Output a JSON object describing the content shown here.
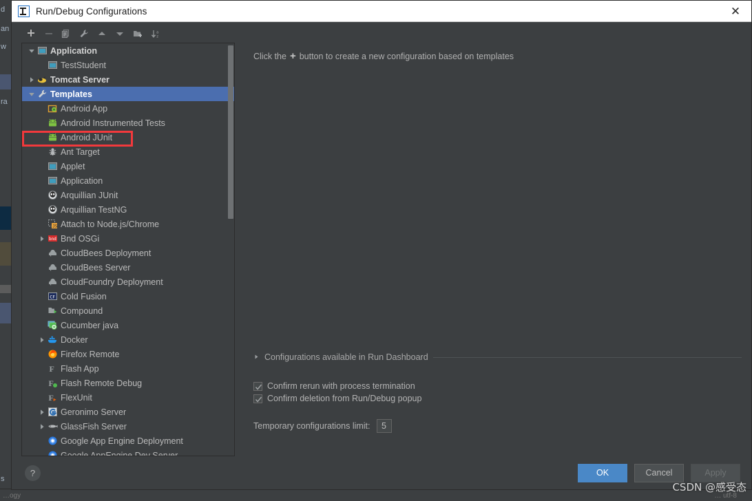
{
  "window": {
    "title": "Run/Debug Configurations",
    "logo_icon": "intellij-idea-logo-icon",
    "close_icon": "close-icon"
  },
  "toolbar": {
    "buttons": [
      {
        "name": "add-configuration-button",
        "icon": "plus-icon",
        "label": "+"
      },
      {
        "name": "remove-configuration-button",
        "icon": "minus-icon",
        "label": "−"
      },
      {
        "name": "copy-configuration-button",
        "icon": "copy-icon",
        "label": "Copy"
      },
      {
        "name": "edit-defaults-button",
        "icon": "wrench-icon",
        "label": "Edit defaults"
      },
      {
        "name": "move-up-button",
        "icon": "arrow-up-icon",
        "label": "Move Up"
      },
      {
        "name": "move-down-button",
        "icon": "arrow-down-icon",
        "label": "Move Down"
      },
      {
        "name": "new-folder-button",
        "icon": "folder-add-icon",
        "label": "New Folder"
      },
      {
        "name": "sort-configurations-button",
        "icon": "sort-alpha-icon",
        "label": "Sort Configurations"
      }
    ]
  },
  "tree": {
    "items": [
      {
        "label": "Application",
        "icon": "application-icon",
        "indent": 0,
        "twisty": "down",
        "bold": true,
        "selected": false
      },
      {
        "label": "TestStudent",
        "icon": "application-icon",
        "indent": 1,
        "twisty": "none",
        "bold": false,
        "selected": false
      },
      {
        "label": "Tomcat Server",
        "icon": "tomcat-icon",
        "indent": 0,
        "twisty": "right",
        "bold": true,
        "selected": false
      },
      {
        "label": "Templates",
        "icon": "wrench-icon",
        "indent": 0,
        "twisty": "down",
        "bold": true,
        "selected": true
      },
      {
        "label": "Android App",
        "icon": "android-app-icon",
        "indent": 1,
        "twisty": "none",
        "bold": false,
        "selected": false
      },
      {
        "label": "Android Instrumented Tests",
        "icon": "android-icon",
        "indent": 1,
        "twisty": "none",
        "bold": false,
        "selected": false
      },
      {
        "label": "Android JUnit",
        "icon": "android-icon",
        "indent": 1,
        "twisty": "none",
        "bold": false,
        "selected": false
      },
      {
        "label": "Ant Target",
        "icon": "ant-icon",
        "indent": 1,
        "twisty": "none",
        "bold": false,
        "selected": false
      },
      {
        "label": "Applet",
        "icon": "applet-icon",
        "indent": 1,
        "twisty": "none",
        "bold": false,
        "selected": false
      },
      {
        "label": "Application",
        "icon": "application-icon",
        "indent": 1,
        "twisty": "none",
        "bold": false,
        "selected": false
      },
      {
        "label": "Arquillian JUnit",
        "icon": "arquillian-icon",
        "indent": 1,
        "twisty": "none",
        "bold": false,
        "selected": false
      },
      {
        "label": "Arquillian TestNG",
        "icon": "arquillian-icon",
        "indent": 1,
        "twisty": "none",
        "bold": false,
        "selected": false
      },
      {
        "label": "Attach to Node.js/Chrome",
        "icon": "nodejs-attach-icon",
        "indent": 1,
        "twisty": "none",
        "bold": false,
        "selected": false
      },
      {
        "label": "Bnd OSGi",
        "icon": "bnd-osgi-icon",
        "indent": 1,
        "twisty": "right",
        "bold": false,
        "selected": false
      },
      {
        "label": "CloudBees Deployment",
        "icon": "cloudbees-icon",
        "indent": 1,
        "twisty": "none",
        "bold": false,
        "selected": false
      },
      {
        "label": "CloudBees Server",
        "icon": "cloudbees-icon",
        "indent": 1,
        "twisty": "none",
        "bold": false,
        "selected": false
      },
      {
        "label": "CloudFoundry Deployment",
        "icon": "cloudfoundry-icon",
        "indent": 1,
        "twisty": "none",
        "bold": false,
        "selected": false
      },
      {
        "label": "Cold Fusion",
        "icon": "coldfusion-icon",
        "indent": 1,
        "twisty": "none",
        "bold": false,
        "selected": false
      },
      {
        "label": "Compound",
        "icon": "compound-icon",
        "indent": 1,
        "twisty": "none",
        "bold": false,
        "selected": false
      },
      {
        "label": "Cucumber java",
        "icon": "cucumber-icon",
        "indent": 1,
        "twisty": "none",
        "bold": false,
        "selected": false
      },
      {
        "label": "Docker",
        "icon": "docker-icon",
        "indent": 1,
        "twisty": "right",
        "bold": false,
        "selected": false
      },
      {
        "label": "Firefox Remote",
        "icon": "firefox-icon",
        "indent": 1,
        "twisty": "none",
        "bold": false,
        "selected": false
      },
      {
        "label": "Flash App",
        "icon": "flash-icon",
        "indent": 1,
        "twisty": "none",
        "bold": false,
        "selected": false
      },
      {
        "label": "Flash Remote Debug",
        "icon": "flash-debug-icon",
        "indent": 1,
        "twisty": "none",
        "bold": false,
        "selected": false
      },
      {
        "label": "FlexUnit",
        "icon": "flexunit-icon",
        "indent": 1,
        "twisty": "none",
        "bold": false,
        "selected": false
      },
      {
        "label": "Geronimo Server",
        "icon": "geronimo-icon",
        "indent": 1,
        "twisty": "right",
        "bold": false,
        "selected": false
      },
      {
        "label": "GlassFish Server",
        "icon": "glassfish-icon",
        "indent": 1,
        "twisty": "right",
        "bold": false,
        "selected": false
      },
      {
        "label": "Google App Engine Deployment",
        "icon": "google-appengine-icon",
        "indent": 1,
        "twisty": "none",
        "bold": false,
        "selected": false
      },
      {
        "label": "Google AppEngine Dev Server",
        "icon": "google-appengine-icon",
        "indent": 1,
        "twisty": "none",
        "bold": false,
        "selected": false
      }
    ]
  },
  "right_panel": {
    "hint_prefix": "Click the",
    "hint_plus": "+",
    "hint_suffix": "button to create a new configuration based on templates",
    "run_dashboard": {
      "label": "Configurations available in Run Dashboard",
      "expander_icon": "chevron-right-icon",
      "expanded": false
    },
    "checkboxes": [
      {
        "label": "Confirm rerun with process termination",
        "checked": true
      },
      {
        "label": "Confirm deletion from Run/Debug popup",
        "checked": true
      }
    ],
    "temporary_limit": {
      "label": "Temporary configurations limit:",
      "value": "5"
    }
  },
  "footer": {
    "help_label": "?",
    "ok_label": "OK",
    "cancel_label": "Cancel",
    "apply_label": "Apply"
  },
  "watermark": "CSDN @感受态",
  "background_ide": {
    "left_text": [
      "d",
      "an",
      "w",
      "ra",
      "s"
    ],
    "bottom_text_left": "…ogy",
    "bottom_text_right": "… utf-8"
  },
  "colors": {
    "dialog_bg": "#3c3f41",
    "selection": "#4b6eaf",
    "annotation_red": "#f2393c",
    "primary_button": "#4a88c7",
    "text": "#bbbbbb"
  }
}
